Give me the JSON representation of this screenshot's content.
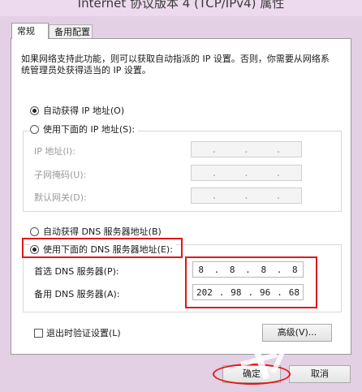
{
  "window": {
    "title": "Internet 协议版本 4 (TCP/IPv4) 属性"
  },
  "tabs": [
    {
      "label": "常规",
      "active": true
    },
    {
      "label": "备用配置",
      "active": false
    }
  ],
  "description": "如果网络支持此功能，则可以获取自动指派的 IP 设置。否则，你需要从网络系统管理员处获得适当的 IP 设置。",
  "ip": {
    "auto_label": "自动获得 IP 地址(O)",
    "auto_selected": true,
    "manual_label": "使用下面的 IP 地址(S):",
    "manual_selected": false,
    "fields": [
      {
        "label": "IP 地址(I):",
        "octets": [
          "",
          "",
          "",
          ""
        ]
      },
      {
        "label": "子网掩码(U):",
        "octets": [
          "",
          "",
          "",
          ""
        ]
      },
      {
        "label": "默认网关(D):",
        "octets": [
          "",
          "",
          "",
          ""
        ]
      }
    ]
  },
  "dns": {
    "auto_label": "自动获得 DNS 服务器地址(B)",
    "auto_selected": false,
    "manual_label": "使用下面的 DNS 服务器地址(E):",
    "manual_selected": true,
    "fields": [
      {
        "label": "首选 DNS 服务器(P):",
        "octets": [
          "8",
          "8",
          "8",
          "8"
        ]
      },
      {
        "label": "备用 DNS 服务器(A):",
        "octets": [
          "202",
          "98",
          "96",
          "68"
        ]
      }
    ]
  },
  "validate_label": "退出时验证设置(L)",
  "advanced_label": "高级(V)...",
  "ok_label": "确定",
  "cancel_label": "取消",
  "colors": {
    "highlight": "#e01818",
    "window_bg": "#e3d0e4"
  }
}
